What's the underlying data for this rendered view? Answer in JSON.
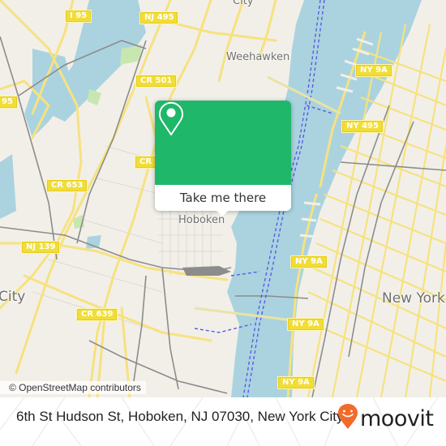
{
  "map": {
    "colors": {
      "land": "#f2efe9",
      "water": "#aad3df",
      "park": "#c8e6b0",
      "major_road": "#f6e27f",
      "road_casing": "#e8cd3a",
      "rail": "#8c8c8c",
      "ferry": "#5a5ae6",
      "shield_fill": "#f1dd38"
    },
    "road_shields": [
      {
        "label": "I 95"
      },
      {
        "label": "NJ 495"
      },
      {
        "label": "CR 501"
      },
      {
        "label": "95"
      },
      {
        "label": "CR 653"
      },
      {
        "label": "CR"
      },
      {
        "label": "NJ 139"
      },
      {
        "label": "CR 639"
      },
      {
        "label": "NY 9A"
      },
      {
        "label": "NY 495"
      },
      {
        "label": "NY 9A"
      },
      {
        "label": "NY 9A"
      },
      {
        "label": "NY 9A"
      }
    ],
    "places": [
      {
        "label": "City"
      },
      {
        "label": "Weehawken"
      },
      {
        "label": "Hoboken"
      },
      {
        "label": "New York"
      },
      {
        "label": "City"
      }
    ]
  },
  "popup": {
    "icon": "map-pin-icon",
    "button_label": "Take me there",
    "accent_color": "#1fb769"
  },
  "attribution": "© OpenStreetMap contributors",
  "footer": {
    "address": "6th St Hudson St, Hoboken, NJ 07030, New York City",
    "brand": "moovit",
    "brand_icon": "moovit-smile-pin-icon",
    "brand_color": "#f26b2a"
  }
}
